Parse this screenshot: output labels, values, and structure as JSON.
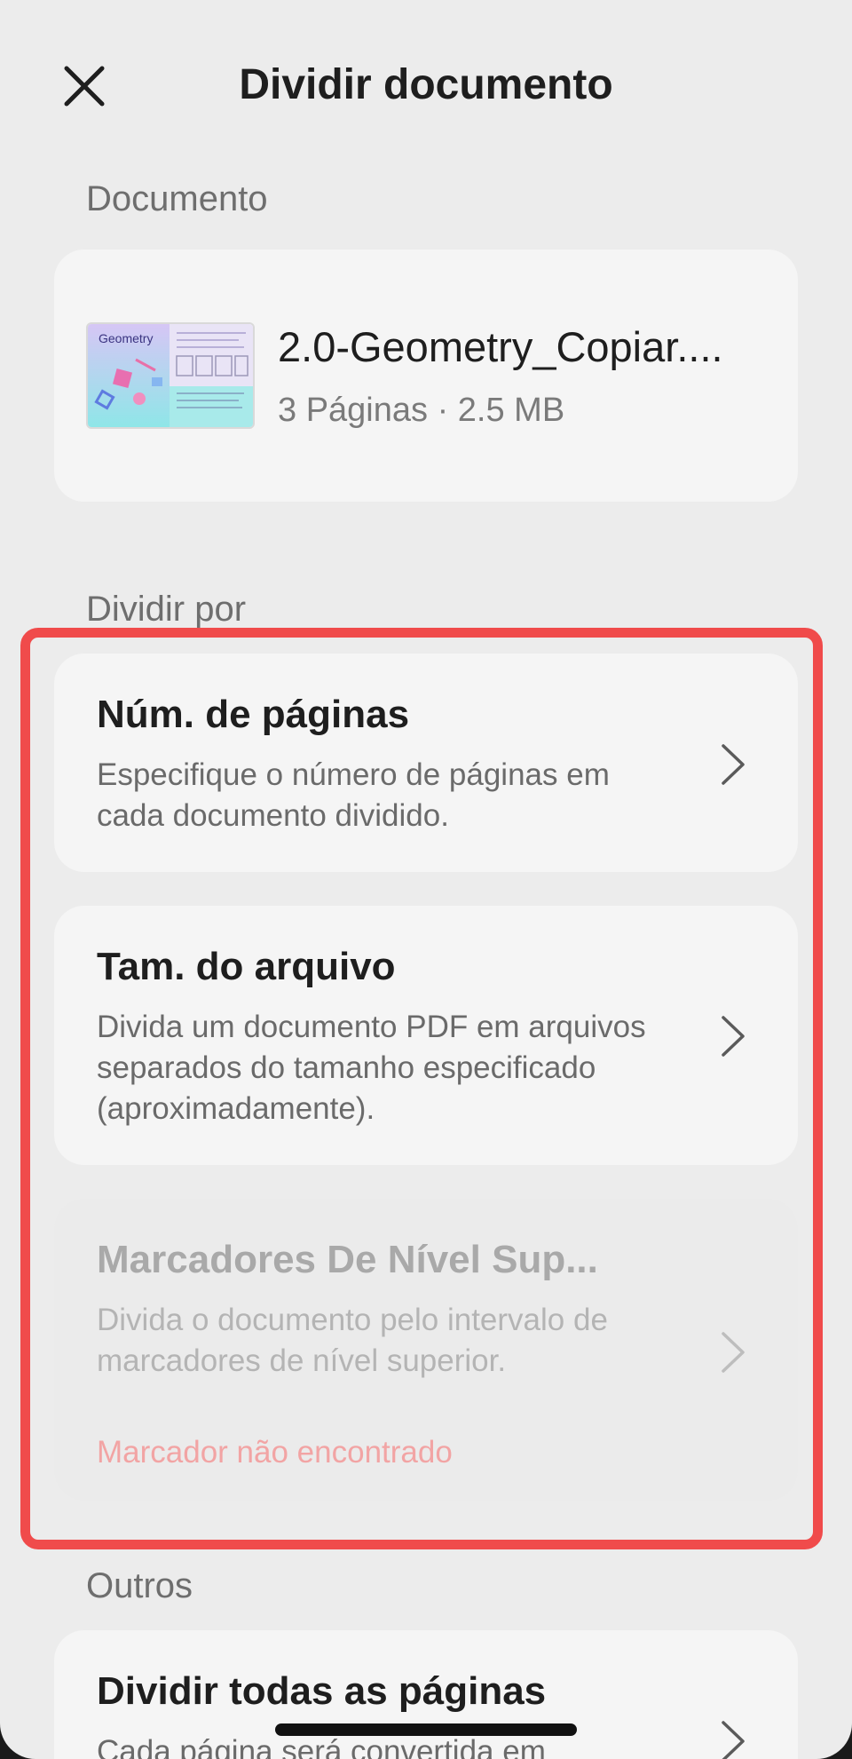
{
  "header": {
    "title": "Dividir documento",
    "close_icon": "close-icon"
  },
  "document_section": {
    "label": "Documento",
    "file_name": "2.0-Geometry_Copiar....",
    "meta": "3 Páginas · 2.5 MB",
    "thumbnail_text": "Geometry"
  },
  "split_section": {
    "label": "Dividir por",
    "options": [
      {
        "title": "Núm. de páginas",
        "description": "Especifique o número de páginas em cada documento dividido."
      },
      {
        "title": "Tam. do arquivo",
        "description": "Divida um documento PDF em arquivos separados do tamanho especificado (aproximadamente)."
      },
      {
        "title": "Marcadores De Nível Sup...",
        "description": "Divida o documento pelo intervalo de marcadores de nível superior.",
        "error": "Marcador não encontrado",
        "disabled": true
      }
    ]
  },
  "others_section": {
    "label": "Outros",
    "options": [
      {
        "title": "Dividir todas as páginas",
        "description": "Cada página será convertida em"
      }
    ]
  },
  "colors": {
    "highlight": "#f04b4b",
    "error_text": "#f2a4a4",
    "background": "#ececec",
    "card": "#f5f5f5"
  }
}
